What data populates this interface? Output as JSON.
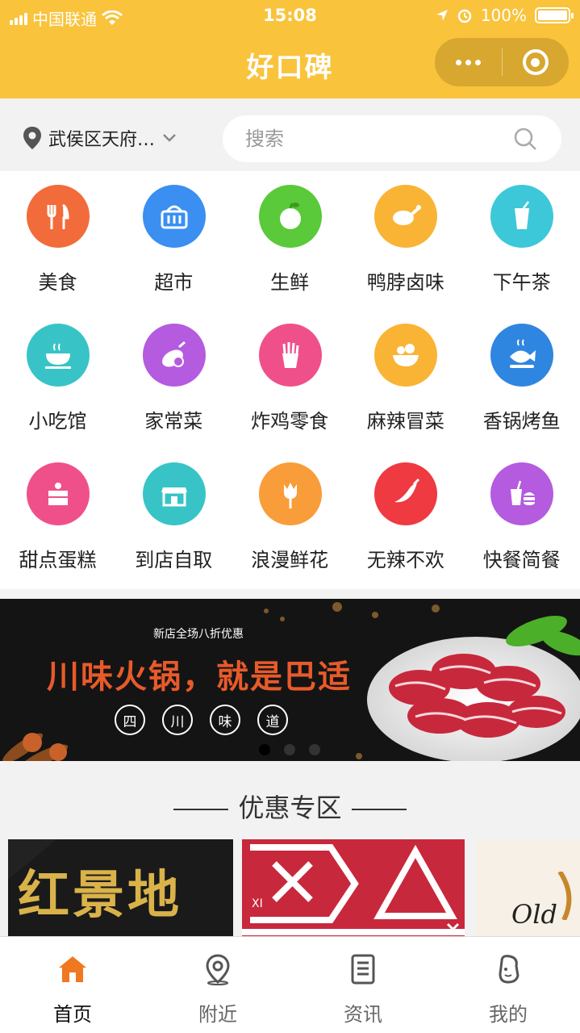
{
  "status_bar": {
    "carrier": "中国联通",
    "time": "15:08",
    "battery": "100%"
  },
  "header": {
    "title": "好口碑",
    "more_icon": "more-dots-icon",
    "close_icon": "target-circle-icon"
  },
  "location": {
    "text": "武侯区天府…"
  },
  "search": {
    "placeholder": "搜索"
  },
  "categories": [
    {
      "label": "美食",
      "icon": "fork-knife-icon",
      "color": "#f26b3a"
    },
    {
      "label": "超市",
      "icon": "basket-icon",
      "color": "#3a8ff0"
    },
    {
      "label": "生鲜",
      "icon": "apple-icon",
      "color": "#5ac93a"
    },
    {
      "label": "鸭脖卤味",
      "icon": "drumstick-icon",
      "color": "#f9b435"
    },
    {
      "label": "下午茶",
      "icon": "drink-cup-icon",
      "color": "#3cc8d8"
    },
    {
      "label": "小吃馆",
      "icon": "bowl-icon",
      "color": "#38c4c6"
    },
    {
      "label": "家常菜",
      "icon": "eggplant-icon",
      "color": "#b45be0"
    },
    {
      "label": "炸鸡零食",
      "icon": "fries-icon",
      "color": "#f0508a"
    },
    {
      "label": "麻辣冒菜",
      "icon": "hotpot-bowl-icon",
      "color": "#f9b435"
    },
    {
      "label": "香锅烤鱼",
      "icon": "fish-icon",
      "color": "#2f86e0"
    },
    {
      "label": "甜点蛋糕",
      "icon": "cake-icon",
      "color": "#f0508a"
    },
    {
      "label": "到店自取",
      "icon": "storefront-icon",
      "color": "#38c4c6"
    },
    {
      "label": "浪漫鲜花",
      "icon": "tulip-icon",
      "color": "#f99c3a"
    },
    {
      "label": "无辣不欢",
      "icon": "chili-icon",
      "color": "#ee3a40"
    },
    {
      "label": "快餐简餐",
      "icon": "fastfood-icon",
      "color": "#b45be0"
    }
  ],
  "banner": {
    "promo": "新店全场八折优惠",
    "slogan": "川味火锅，就是巴适",
    "tags": [
      "四",
      "川",
      "味",
      "道"
    ],
    "active_index": 0
  },
  "section": {
    "title": "优惠专区"
  },
  "promo_cards": [
    {
      "text": "红景地"
    },
    {
      "text": "XI"
    },
    {
      "text": "Old"
    }
  ],
  "tabbar": [
    {
      "label": "首页",
      "icon": "home-icon",
      "active": true
    },
    {
      "label": "附近",
      "icon": "location-pin-icon",
      "active": false
    },
    {
      "label": "资讯",
      "icon": "document-icon",
      "active": false
    },
    {
      "label": "我的",
      "icon": "user-face-icon",
      "active": false
    }
  ]
}
